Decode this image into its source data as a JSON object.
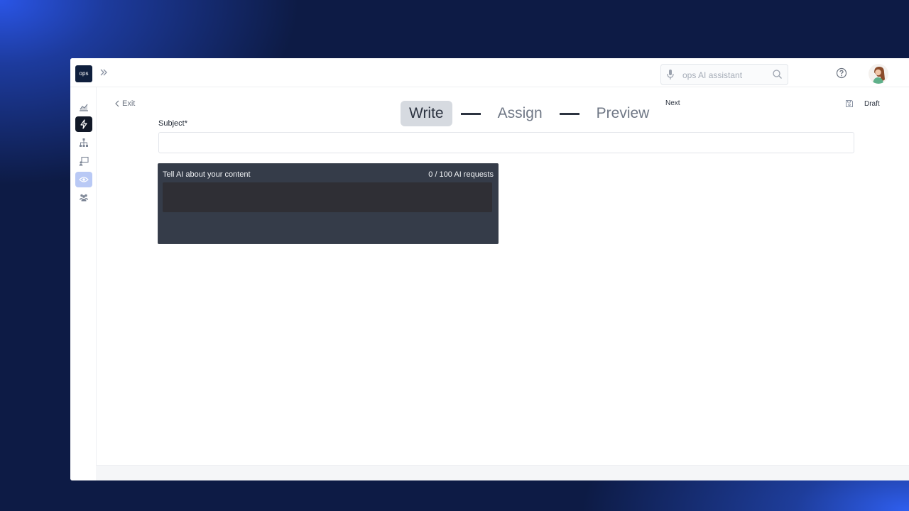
{
  "topbar": {
    "logo_text": "ops",
    "search_placeholder": "ops AI assistant"
  },
  "sidebar": {
    "items": [
      {
        "icon": "analytics-icon"
      },
      {
        "icon": "lightning-icon",
        "active": true
      },
      {
        "icon": "org-chart-icon"
      },
      {
        "icon": "presentation-icon"
      },
      {
        "icon": "eye-icon",
        "highlighted": true
      },
      {
        "icon": "team-icon"
      }
    ]
  },
  "toolbar": {
    "exit_label": "Exit",
    "next_label": "Next",
    "draft_label": "Draft"
  },
  "steps": [
    {
      "label": "Write",
      "active": true
    },
    {
      "label": "Assign",
      "active": false
    },
    {
      "label": "Preview",
      "active": false
    }
  ],
  "form": {
    "subject_label": "Subject*",
    "subject_value": ""
  },
  "ai_panel": {
    "title": "Tell AI about your content",
    "requests": "0 / 100 AI requests",
    "prompt_value": ""
  },
  "colors": {
    "background": "#0d1b45",
    "accent_blue": "#2a55e6",
    "ai_panel_bg": "#353c49",
    "active_step_bg": "#d6dae0"
  }
}
